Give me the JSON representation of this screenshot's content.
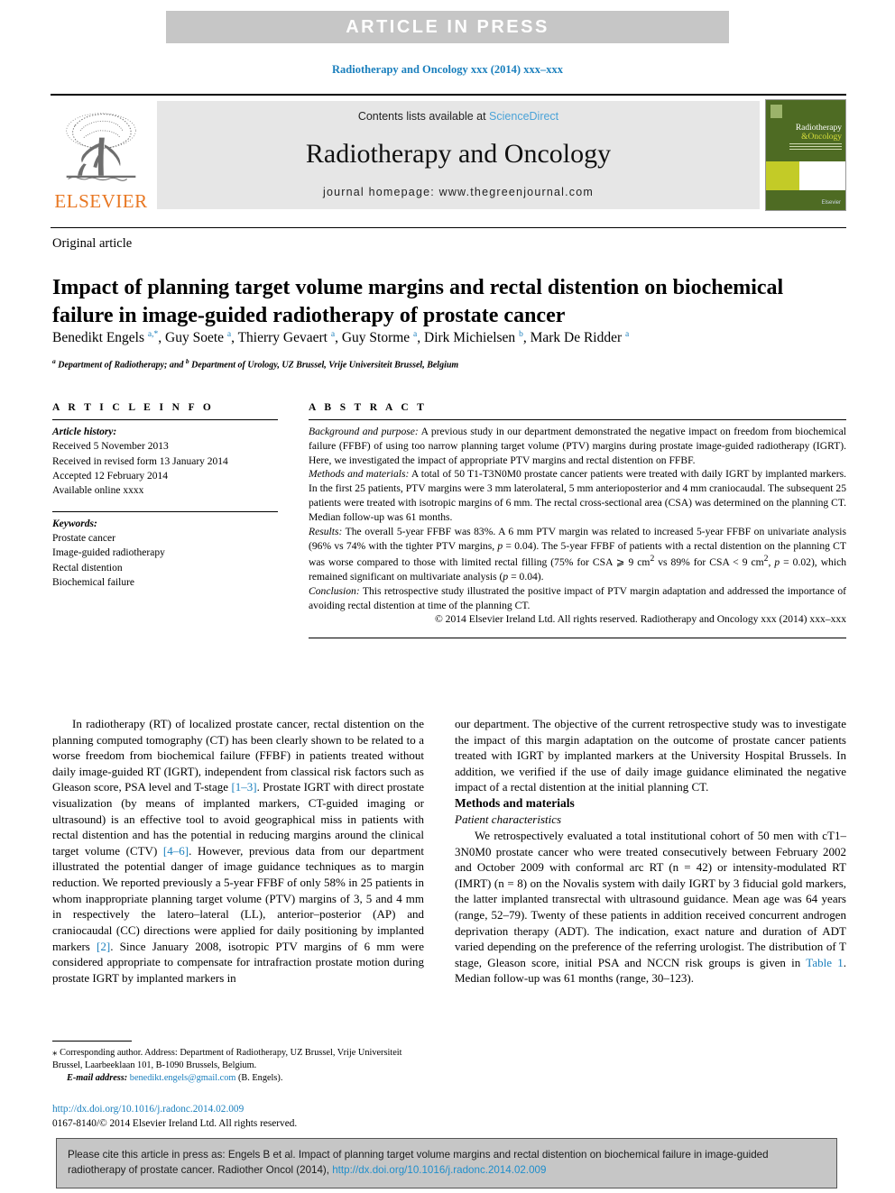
{
  "banner": {
    "text": "ARTICLE  IN  PRESS"
  },
  "journal_ref": "Radiotherapy and Oncology xxx (2014) xxx–xxx",
  "masthead": {
    "contents_prefix": "Contents lists available at ",
    "sciencedirect": "ScienceDirect",
    "journal_title": "Radiotherapy and Oncology",
    "homepage": "journal homepage: www.thegreenjournal.com",
    "publisher": "ELSEVIER",
    "cover": {
      "line1": "Radiotherapy",
      "line2": "&Oncology",
      "mark": "Elsevier"
    }
  },
  "article_type": "Original article",
  "title": "Impact of planning target volume margins and rectal distention on biochemical failure in image-guided radiotherapy of prostate cancer",
  "authors_html": "Benedikt Engels <sup>a,*</sup>, Guy Soete <sup>a</sup>, Thierry Gevaert <sup>a</sup>, Guy Storme <sup>a</sup>, Dirk Michielsen <sup>b</sup>, Mark De Ridder <sup>a</sup>",
  "affiliation_html": "<sup>a</sup> Department of Radiotherapy; and <sup>b</sup> Department of Urology, UZ Brussel, Vrije Universiteit Brussel, Belgium",
  "article_info": {
    "heading": "A R T I C L E   I N F O",
    "history_label": "Article history:",
    "history": [
      "Received 5 November 2013",
      "Received in revised form 13 January 2014",
      "Accepted 12 February 2014",
      "Available online xxxx"
    ],
    "keywords_label": "Keywords:",
    "keywords": [
      "Prostate cancer",
      "Image-guided radiotherapy",
      "Rectal distention",
      "Biochemical failure"
    ]
  },
  "abstract": {
    "heading": "A B S T R A C T",
    "background_label": "Background and purpose:",
    "background": " A previous study in our department demonstrated the negative impact on freedom from biochemical failure (FFBF) of using too narrow planning target volume (PTV) margins during prostate image-guided radiotherapy (IGRT). Here, we investigated the impact of appropriate PTV margins and rectal distention on FFBF.",
    "methods_label": "Methods and materials:",
    "methods": " A total of 50 T1-T3N0M0 prostate cancer patients were treated with daily IGRT by implanted markers. In the first 25 patients, PTV margins were 3 mm laterolateral, 5 mm anterioposterior and 4 mm craniocaudal. The subsequent 25 patients were treated with isotropic margins of 6 mm. The rectal cross-sectional area (CSA) was determined on the planning CT. Median follow-up was 61 months.",
    "results_label": "Results:",
    "results_html": " The overall 5-year FFBF was 83%. A 6 mm PTV margin was related to increased 5-year FFBF on univariate analysis (96% vs 74% with the tighter PTV margins, <i>p</i> = 0.04). The 5-year FFBF of patients with a rectal distention on the planning CT was worse compared to those with limited rectal filling (75% for CSA ⩾ 9 cm<sup>2</sup> vs 89% for CSA &lt; 9 cm<sup>2</sup>, <i>p</i> = 0.02), which remained significant on multivariate analysis (<i>p</i> = 0.04).",
    "conclusion_label": "Conclusion:",
    "conclusion": " This retrospective study illustrated the positive impact of PTV margin adaptation and addressed the importance of avoiding rectal distention at time of the planning CT.",
    "copyright": "© 2014 Elsevier Ireland Ltd. All rights reserved. Radiotherapy and Oncology xxx (2014) xxx–xxx"
  },
  "body": {
    "intro_html": "In radiotherapy (RT) of localized prostate cancer, rectal distention on the planning computed tomography (CT) has been clearly shown to be related to a worse freedom from biochemical failure (FFBF) in patients treated without daily image-guided RT (IGRT), independent from classical risk factors such as Gleason score, PSA level and T-stage <span class=\"lnk\">[1–3]</span>. Prostate IGRT with direct prostate visualization (by means of implanted markers, CT-guided imaging or ultrasound) is an effective tool to avoid geographical miss in patients with rectal distention and has the potential in reducing margins around the clinical target volume (CTV) <span class=\"lnk\">[4–6]</span>. However, previous data from our department illustrated the potential danger of image guidance techniques as to margin reduction. We reported previously a 5-year FFBF of only 58% in 25 patients in whom inappropriate planning target volume (PTV) margins of 3, 5 and 4 mm in respectively the latero–lateral (LL), anterior–posterior (AP) and craniocaudal (CC) directions were applied for daily positioning by implanted markers <span class=\"lnk\">[2]</span>. Since January 2008, isotropic PTV margins of 6 mm were considered appropriate to compensate for intrafraction prostate motion during prostate IGRT by implanted markers in",
    "intro_cont_html": "our department. The objective of the current retrospective study was to investigate the impact of this margin adaptation on the outcome of prostate cancer patients treated with IGRT by implanted markers at the University Hospital Brussels. In addition, we verified if the use of daily image guidance eliminated the negative impact of a rectal distention at the initial planning CT.",
    "methods_heading": "Methods and materials",
    "patient_heading": "Patient characteristics",
    "patient_html": "We retrospectively evaluated a total institutional cohort of 50 men with cT1–3N0M0 prostate cancer who were treated consecutively between February 2002 and October 2009 with conformal arc RT (n = 42) or intensity-modulated RT (IMRT) (n = 8) on the Novalis system with daily IGRT by 3 fiducial gold markers, the latter implanted transrectal with ultrasound guidance. Mean age was 64 years (range, 52–79). Twenty of these patients in addition received concurrent androgen deprivation therapy (ADT). The indication, exact nature and duration of ADT varied depending on the preference of the referring urologist. The distribution of T stage, Gleason score, initial PSA and NCCN risk groups is given in <span class=\"lnk\">Table 1</span>. Median follow-up was 61 months (range, 30–123)."
  },
  "footnotes": {
    "corresponding_html": "<span class=\"star\">⁎</span> Corresponding author. Address: Department of Radiotherapy, UZ Brussel, Vrije Universiteit Brussel, Laarbeeklaan 101, B-1090 Brussels, Belgium.",
    "email_label": "E-mail address:",
    "email": "benedikt.engels@gmail.com",
    "email_suffix": " (B. Engels)."
  },
  "doi": {
    "url": "http://dx.doi.org/10.1016/j.radonc.2014.02.009",
    "issn_line": "0167-8140/© 2014 Elsevier Ireland Ltd. All rights reserved."
  },
  "citation_box": {
    "text_before": "Please cite this article in press as: Engels B et al. Impact of planning target volume margins and rectal distention on biochemical failure in image-guided radiotherapy of prostate cancer. Radiother Oncol (2014), ",
    "link": "http://dx.doi.org/10.1016/j.radonc.2014.02.009"
  },
  "colors": {
    "link_blue": "#1a7fbd",
    "elsevier_orange": "#e87722",
    "banner_gray": "#c6c6c6",
    "masthead_gray": "#e6e6e6",
    "cover_green": "#4e6b23",
    "cover_yellow": "#c3cb27"
  }
}
